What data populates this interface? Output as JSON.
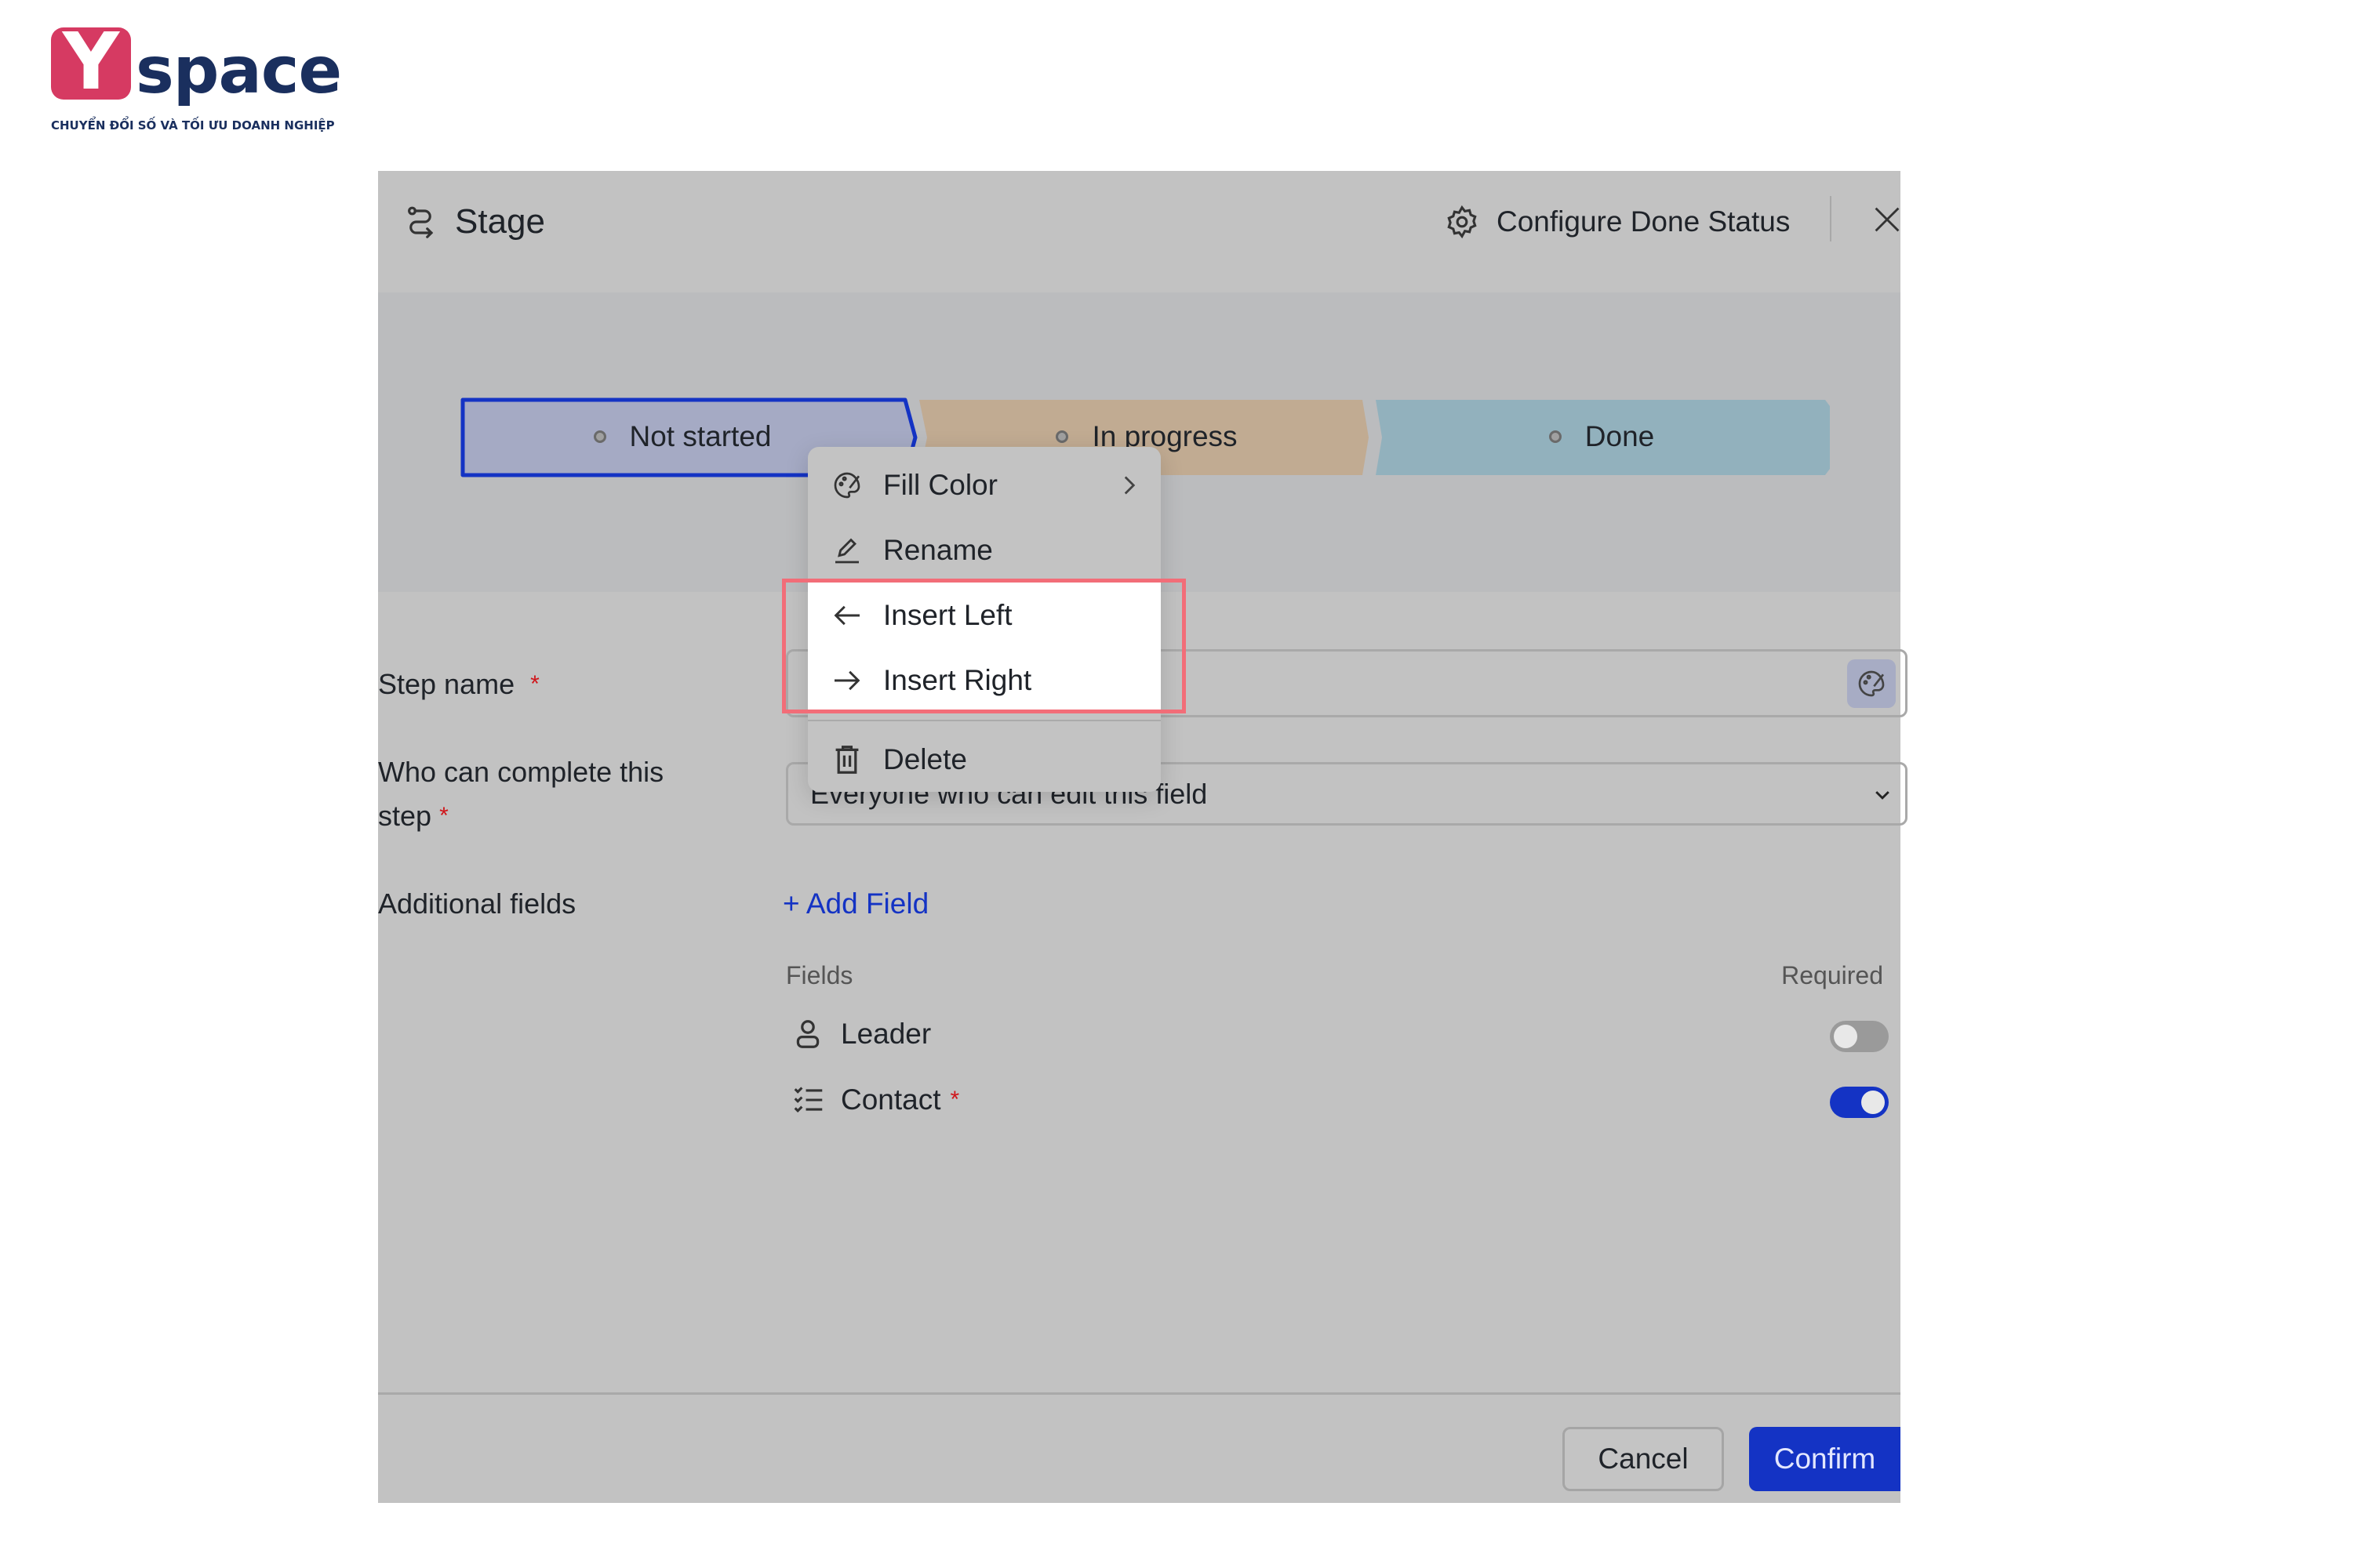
{
  "logo": {
    "letter": "Y",
    "word": "space",
    "tagline": "CHUYỂN ĐỔI SỐ VÀ TỐI ƯU DOANH NGHIỆP"
  },
  "dialog": {
    "title": "Stage",
    "title_icon": "stage-flow-icon",
    "configure_label": "Configure Done Status",
    "configure_icon": "gear-icon",
    "close_icon": "close-icon",
    "stages": [
      {
        "label": "Not started",
        "color": "#a5aac4",
        "selected": true
      },
      {
        "label": "In progress",
        "color": "#c1ab92"
      },
      {
        "label": "Done",
        "color": "#92b1bd"
      }
    ],
    "context_menu": [
      {
        "label": "Fill Color",
        "icon": "palette-icon",
        "submenu": true
      },
      {
        "label": "Rename",
        "icon": "pencil-icon"
      },
      {
        "label": "Insert Left",
        "icon": "arrow-left-icon",
        "highlighted": true
      },
      {
        "label": "Insert Right",
        "icon": "arrow-right-icon",
        "highlighted": true
      },
      {
        "label": "Delete",
        "icon": "trash-icon"
      }
    ],
    "form": {
      "step_name_label": "Step name",
      "required_mark": "*",
      "step_name_value": "",
      "who_label_1": "Who can complete this",
      "who_label_2": "step",
      "who_value": "Everyone who can edit this field",
      "additional_label": "Additional fields",
      "add_field": "+ Add Field",
      "fields_header": "Fields",
      "required_header": "Required",
      "fields": [
        {
          "label": "Leader",
          "icon": "person-icon",
          "required_mark": "",
          "required": false
        },
        {
          "label": "Contact",
          "icon": "checklist-icon",
          "required_mark": "*",
          "required": true
        }
      ]
    },
    "footer": {
      "cancel": "Cancel",
      "confirm": "Confirm"
    }
  },
  "colors": {
    "accent": "#1433c4",
    "highlight_box": "#f26d78",
    "required": "#d0161b"
  }
}
